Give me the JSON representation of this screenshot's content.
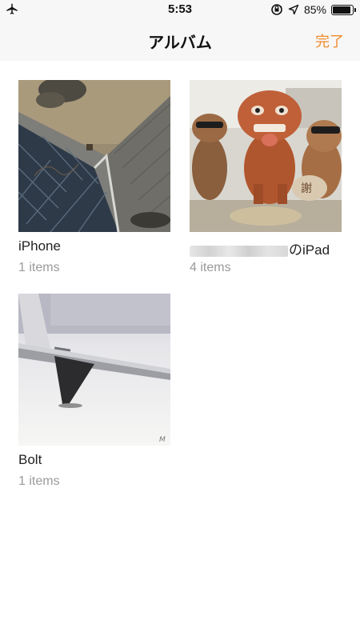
{
  "status_bar": {
    "time": "5:53",
    "battery_percent": "85%",
    "battery_level": 0.85
  },
  "nav": {
    "title": "アルバム",
    "done_label": "完了"
  },
  "albums": [
    {
      "name": "iPhone",
      "count": "1 items"
    },
    {
      "name_suffix": "のiPad",
      "count": "4 items"
    },
    {
      "name": "Bolt",
      "count": "1 items"
    }
  ],
  "colors": {
    "accent": "#f08a2b",
    "nav_bg": "#f7f7f7",
    "secondary_text": "#9a9a9a"
  },
  "icons": [
    "airplane-icon",
    "orientation-lock-icon",
    "location-arrow-icon",
    "battery-icon"
  ]
}
